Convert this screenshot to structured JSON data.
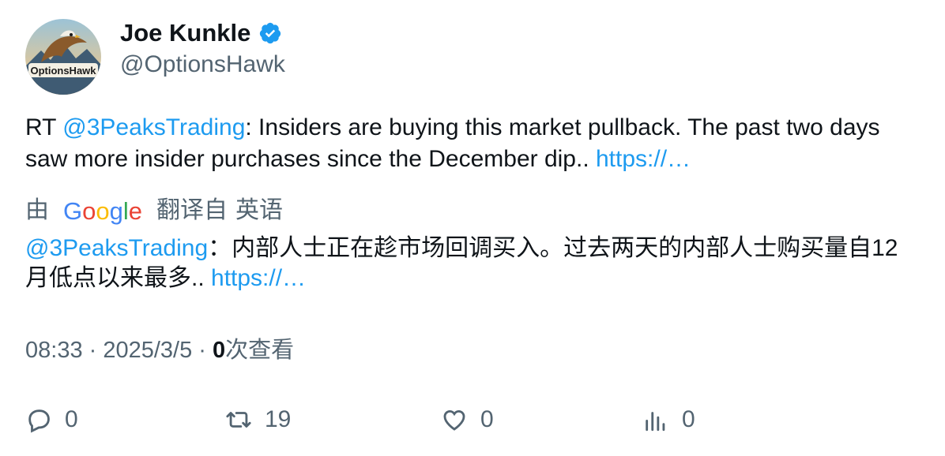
{
  "author": {
    "name": "Joe Kunkle",
    "handle": "@OptionsHawk",
    "avatar_text": "OptionsHawk",
    "verified": true,
    "verified_color": "#1d9bf0"
  },
  "tweet": {
    "prefix": "RT ",
    "mention": "@3PeaksTrading",
    "body": ": Insiders are buying this market pullback. The past two days saw more insider purchases since the December dip.. ",
    "link": "https://…"
  },
  "translation": {
    "by": "由",
    "provider": "Google",
    "from_label": "翻译自",
    "language": "英语",
    "mention": "@3PeaksTrading",
    "body": "：内部人士正在趁市场回调买入。过去两天的内部人士购买量自12月低点以来最多.. ",
    "link": "https://…"
  },
  "meta": {
    "time": "08:33",
    "separator": " · ",
    "date": "2025/3/5",
    "views_count": "0",
    "views_label": "次查看"
  },
  "actions": {
    "reply_count": "0",
    "retweet_count": "19",
    "like_count": "0",
    "views_count": "0"
  },
  "colors": {
    "link": "#1d9bf0",
    "secondary_text": "#536471",
    "primary_text": "#0f1419"
  }
}
